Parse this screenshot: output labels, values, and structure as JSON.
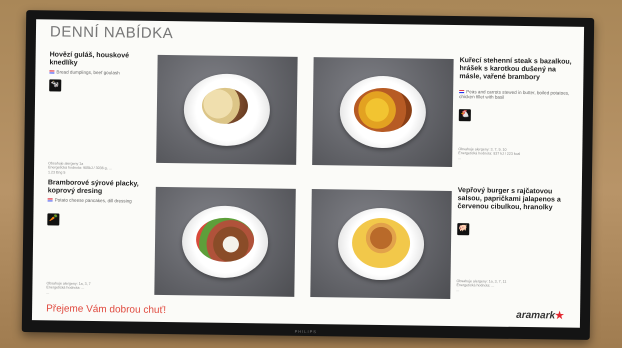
{
  "header": {
    "title": "DENNÍ NABÍDKA"
  },
  "items": [
    {
      "name": "Hovězí guláš, houskové knedlíky",
      "english": "Bread dumplings, beef goulash",
      "icon": "cow-icon",
      "icon_glyph": "🐄",
      "nutrition": "Obsahuje alergeny 1a\nEnergetická hodnota: 905kJ / 3036 g, ...\n1.23 Eng 5"
    },
    {
      "name": "Kuřecí stehenní steak s bazalkou, hrášek s karotkou dušený na másle, vařené brambory",
      "english": "Peas and carrots stewed in butter, boiled potatoes, chicken fillet with basil",
      "icon": "chicken-icon",
      "icon_glyph": "🐔",
      "nutrition": "Obsahuje alergeny: 3, 7, 9, 10\nEnergetická hodnota: 937 kJ / 223 kcal\n..."
    },
    {
      "name": "Bramborové sýrové placky, koprový dresing",
      "english": "Potato cheese pancakes, dill dressing",
      "icon": "carrot-icon",
      "icon_glyph": "🥕",
      "nutrition": "Obsahuje alergeny: 1a, 3, 7\nEnergetická hodnota: ...\n..."
    },
    {
      "name": "Vepřový burger s rajčatovou salsou, papričkami jalapenos a červenou cibulkou, hranolky",
      "english": "",
      "icon": "pig-icon",
      "icon_glyph": "🐖",
      "nutrition": "Obsahuje alergeny: 1a, 3, 7, 11\nEnergetická hodnota: ...\n..."
    }
  ],
  "footer": {
    "text": "Přejeme Vám dobrou chuť!"
  },
  "brand": {
    "name": "aramark",
    "star": "★"
  },
  "tv_brand": "PHILIPS"
}
